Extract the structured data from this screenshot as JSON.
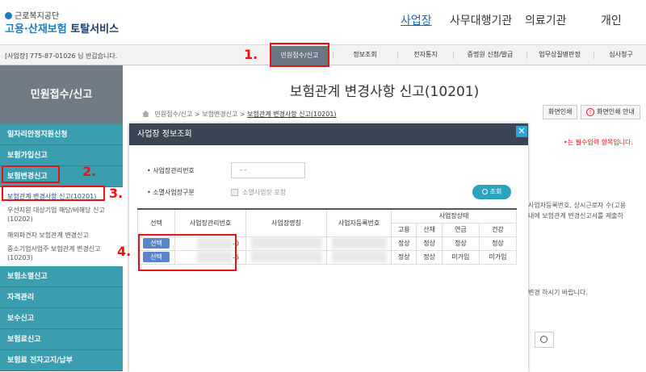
{
  "header": {
    "org": "근로복지공단",
    "service_a": "고용·산재보험",
    "service_b": "토탈서비스",
    "nav": [
      "사업장",
      "사무대행기관",
      "의료기관",
      "개인"
    ]
  },
  "subbar": {
    "welcome": "[사업장] 775-87-01026 님 반갑습니다.",
    "menus": [
      "민원접수/신고",
      "정보조회",
      "전자통지",
      "증명원 신청/발급",
      "업무상질병판정",
      "심사청구"
    ]
  },
  "steps": [
    "1.",
    "2.",
    "3.",
    "4."
  ],
  "sidebar": {
    "title": "민원접수/신고",
    "items": [
      "일자리안정지원신청",
      "보험가입신고",
      "보험변경신고"
    ],
    "subitems": [
      "보험관계 변경사항 신고(10201)",
      "우선지원 대상기업 해당/비해당 신고(10202)",
      "해외파견자 보험관계 변경신고",
      "중소기업사업주 보험관계 변경신고(10203)"
    ],
    "items2": [
      "보험소멸신고",
      "자격관리",
      "보수신고",
      "보험료신고",
      "보험료 전자고지/납부"
    ]
  },
  "main": {
    "title": "보험관계 변경사항 신고(10201)",
    "breadcrumb": [
      "민원접수/신고",
      "보험변경신고",
      "보험관계 변경사항 신고(10201)"
    ],
    "btn_print": "화면인쇄",
    "btn_print_guide": "화면인쇄 안내",
    "required_note": "•는 필수입력 항목입니다.",
    "bg_text1": "사업자등록번호, 상시근로자 수(고용",
    "bg_text2": "내에 보험관계 변경신고서를 제출하",
    "bg_text3": "변경 하시기 바랍니다."
  },
  "modal": {
    "title": "사업장 정보조회",
    "close": "✕",
    "label_mgmt": "사업장관리번호",
    "mgmt_value": "-   -",
    "label_extinct": "소멸사업장구분",
    "checkbox_label": "소멸사업장 포함",
    "search_btn": "조회",
    "table": {
      "headers": [
        "선택",
        "사업장관리번호",
        "사업장명칭",
        "사업자등록번호"
      ],
      "status_header": "사업장상태",
      "status_cols": [
        "고용",
        "산재",
        "연금",
        "건강"
      ],
      "rows": [
        {
          "select": "선택",
          "mgmt": "-0",
          "status": [
            "정상",
            "정상",
            "정상",
            "정상"
          ]
        },
        {
          "select": "선택",
          "mgmt": "-6",
          "status": [
            "정상",
            "정상",
            "미가입",
            "미가입"
          ]
        }
      ]
    }
  }
}
